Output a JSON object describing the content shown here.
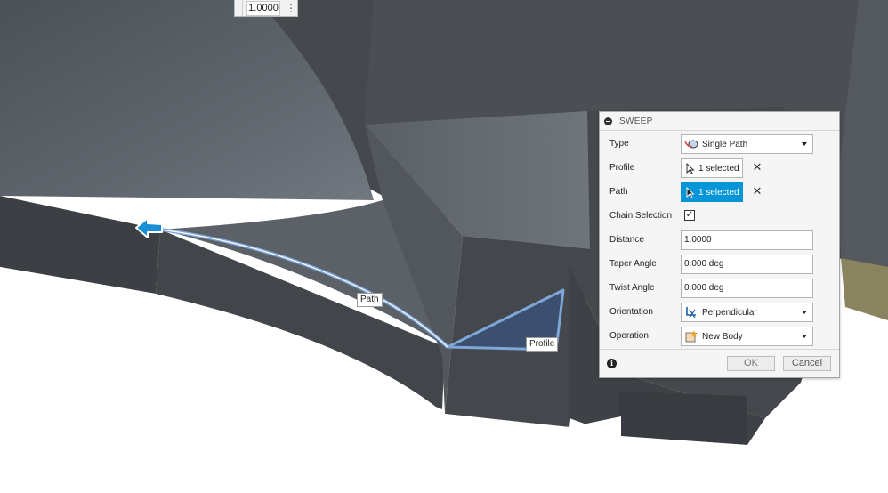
{
  "mini_input": {
    "value": "1.0000",
    "menu_glyph": "⋮"
  },
  "viewport_labels": {
    "path": "Path",
    "profile": "Profile"
  },
  "dialog": {
    "title": "SWEEP",
    "rows": {
      "type": {
        "label": "Type",
        "value": "Single Path",
        "icon": "single-path-icon"
      },
      "profile": {
        "label": "Profile",
        "value": "1 selected"
      },
      "path": {
        "label": "Path",
        "value": "1 selected"
      },
      "chain_selection": {
        "label": "Chain Selection",
        "checked": "✓"
      },
      "distance": {
        "label": "Distance",
        "value": "1.0000"
      },
      "taper_angle": {
        "label": "Taper Angle",
        "value": "0.000 deg"
      },
      "twist_angle": {
        "label": "Twist Angle",
        "value": "0.000 deg"
      },
      "orientation": {
        "label": "Orientation",
        "value": "Perpendicular",
        "icon": "perpendicular-icon"
      },
      "operation": {
        "label": "Operation",
        "value": "New Body",
        "icon": "new-body-icon"
      }
    },
    "clear_glyph": "✕",
    "footer": {
      "info_glyph": "i",
      "ok": "OK",
      "cancel": "Cancel"
    }
  },
  "colors": {
    "accent": "#0696d7",
    "selection_blue": "#7fa6d8",
    "model_dark": "#3f4246",
    "model_mid": "#555a5f",
    "model_light": "#6b7177"
  }
}
